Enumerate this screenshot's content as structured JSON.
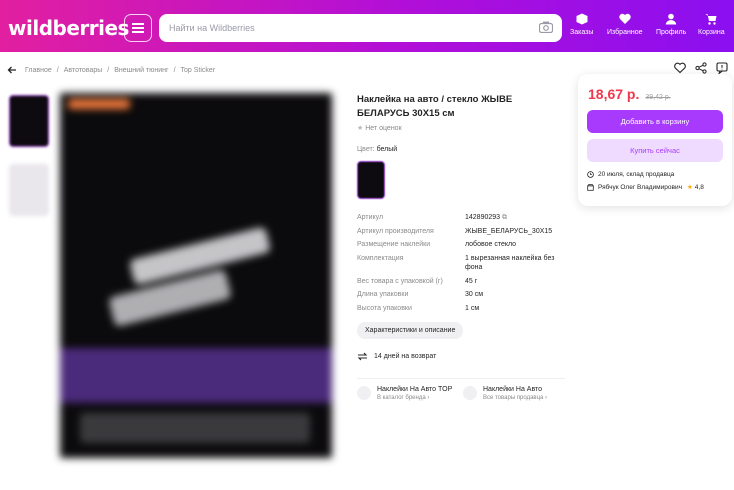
{
  "header": {
    "logo": "wildberries",
    "search_placeholder": "Найти на Wildberries",
    "nav": [
      {
        "label": "Заказы",
        "icon": "box-icon"
      },
      {
        "label": "Избранное",
        "icon": "heart-icon"
      },
      {
        "label": "Профиль",
        "icon": "user-icon"
      },
      {
        "label": "Корзина",
        "icon": "cart-icon"
      }
    ],
    "colors": {
      "gradient_start": "#e21fa0",
      "gradient_end": "#8b0ff0"
    }
  },
  "breadcrumbs": [
    "Главное",
    "Автотовары",
    "Внешний тюнинг",
    "Top Sticker"
  ],
  "product": {
    "title": "Наклейка на авто / стекло ЖЫВЕ БЕЛАРУСЬ 30X15 см",
    "rating": "Нет оценок",
    "color_label": "Цвет:",
    "color_value": "белый",
    "specs": [
      {
        "k": "Артикул",
        "v": "142890293"
      },
      {
        "k": "Артикул производителя",
        "v": "ЖЫВЕ_БЕЛАРУСЬ_30X15"
      },
      {
        "k": "Размещение наклейки",
        "v": "лобовое стекло"
      },
      {
        "k": "Комплектация",
        "v": "1 вырезанная наклейка без фона"
      },
      {
        "k": "Вес товара с упаковкой (г)",
        "v": "45 г"
      },
      {
        "k": "Длина упаковки",
        "v": "30 см"
      },
      {
        "k": "Высота упаковки",
        "v": "1 см"
      }
    ],
    "chars_button": "Характеристики и описание",
    "returns": "14 дней на возврат",
    "brands": [
      {
        "title": "Наклейки На Авто TOP",
        "sub": "В каталог бренда ›"
      },
      {
        "title": "Наклейки На Авто",
        "sub": "Все товары продавца ›"
      }
    ]
  },
  "buy_card": {
    "price": "18,67 р.",
    "old_price": "39,42 р.",
    "add_to_cart": "Добавить в корзину",
    "buy_now": "Купить сейчас",
    "delivery": "20 июля, склад продавца",
    "seller": "Рябчук Олег Владимирович",
    "seller_rating": "4,8",
    "colors": {
      "price": "#f0364c",
      "accent": "#a73afd"
    }
  }
}
